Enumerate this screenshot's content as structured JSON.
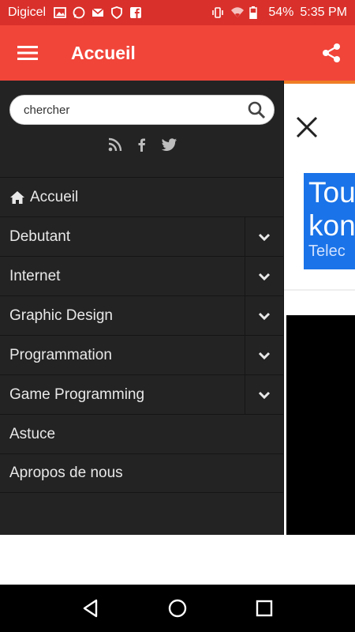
{
  "status_bar": {
    "carrier": "Digicel",
    "battery": "54%",
    "time": "5:35 PM"
  },
  "app_bar": {
    "title": "Accueil"
  },
  "drawer": {
    "search_value": "chercher",
    "menu": [
      {
        "label": "Accueil",
        "icon": "home-icon",
        "expandable": false
      },
      {
        "label": "Debutant",
        "expandable": true
      },
      {
        "label": "Internet",
        "expandable": true
      },
      {
        "label": "Graphic Design",
        "expandable": true
      },
      {
        "label": "Programmation",
        "expandable": true
      },
      {
        "label": "Game Programming",
        "expandable": true
      },
      {
        "label": "Astuce",
        "expandable": false
      },
      {
        "label": "Apropos de nous",
        "expandable": false
      }
    ]
  },
  "background_content": {
    "ad_line1": "Tou",
    "ad_line2": "kon",
    "ad_line3": "Telec"
  },
  "colors": {
    "status_bar": "#d9302b",
    "app_bar": "#f1453a",
    "drawer": "#232323",
    "accent": "#ef7d25",
    "ad": "#1a73e8"
  }
}
